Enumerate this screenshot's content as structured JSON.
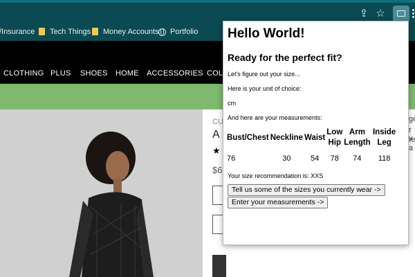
{
  "bookmarks": [
    {
      "label": "/Insurance",
      "icon": "none"
    },
    {
      "label": "Tech Things",
      "icon": "folder-icon"
    },
    {
      "label": "Money Accounts",
      "icon": "folder-icon"
    },
    {
      "label": "Portfolio",
      "icon": "globe-icon"
    }
  ],
  "nav": [
    "CLOTHING",
    "PLUS",
    "SHOES",
    "HOME",
    "ACCESSORIES",
    "COL"
  ],
  "product": {
    "category_partial": "CU",
    "title_partial": "A",
    "price_partial": "$6"
  },
  "side_snippets": [
    "ge",
    "r v",
    "re a"
  ],
  "popup": {
    "title": "Hello World!",
    "subtitle": "Ready for the perfect fit?",
    "intro": "Let's figure out your size...",
    "unit_label": "Here is your unit of choice:",
    "unit_value": "cm",
    "measurements_label": "And here are your measurements:",
    "table": {
      "headers": [
        "Bust/Chest",
        "Neckline",
        "Waist",
        "Low Hip",
        "Arm Length",
        "Inside Leg"
      ],
      "values": [
        "76",
        "30",
        "54",
        "78",
        "74",
        "118"
      ]
    },
    "recommendation": "Your size recommendation is: XXS",
    "button_sizes": "Tell us some of the sizes you currently wear ->",
    "button_measurements": "Enter your measurements ->"
  },
  "colors": {
    "toolbar": "#0b4a52",
    "promo": "#7fb86f",
    "site_nav": "#000000"
  }
}
